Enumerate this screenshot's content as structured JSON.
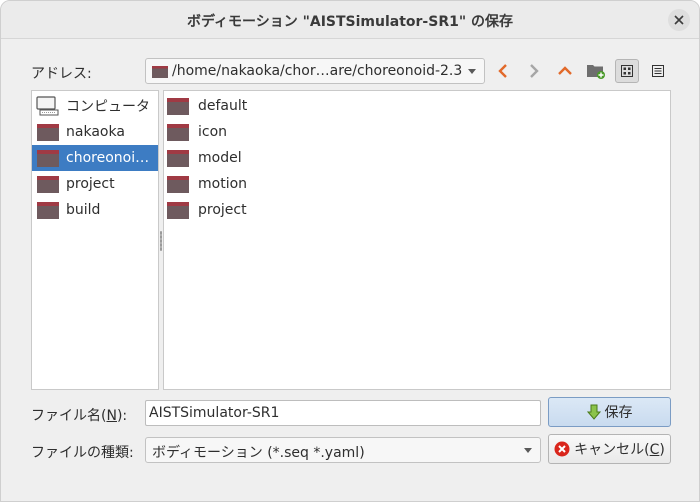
{
  "window": {
    "title": "ボディモーション \"AISTSimulator-SR1\" の保存"
  },
  "address": {
    "label": "アドレス:",
    "path": "/home/nakaoka/chor…are/choreonoid-2.3"
  },
  "toolbar": {
    "icons": [
      "back-icon",
      "forward-icon",
      "parent-dir-icon",
      "new-folder-icon",
      "icon-view-icon",
      "detail-view-icon"
    ]
  },
  "sidebar": {
    "items": [
      {
        "label": "コンピュータ",
        "icon": "computer-icon"
      },
      {
        "label": "nakaoka",
        "icon": "folder-icon"
      },
      {
        "label": "choreonoi…",
        "icon": "folder-icon",
        "selected": true
      },
      {
        "label": "project",
        "icon": "folder-icon"
      },
      {
        "label": "build",
        "icon": "folder-icon"
      }
    ]
  },
  "files": [
    {
      "name": "default"
    },
    {
      "name": "icon"
    },
    {
      "name": "model"
    },
    {
      "name": "motion"
    },
    {
      "name": "project"
    }
  ],
  "filename": {
    "label_prefix": "ファイル名(",
    "label_mnemonic": "N",
    "label_suffix": "):",
    "value": "AISTSimulator-SR1"
  },
  "filetype": {
    "label": "ファイルの種類:",
    "value": "ボディモーション (*.seq *.yaml)"
  },
  "buttons": {
    "save_label": "保存",
    "cancel_prefix": "キャンセル(",
    "cancel_mnemonic": "C",
    "cancel_suffix": ")"
  },
  "colors": {
    "selection": "#3d7cc3",
    "folder_body": "#6e5a5e",
    "folder_tab": "#a03a44",
    "nav_accent": "#e2692a"
  }
}
